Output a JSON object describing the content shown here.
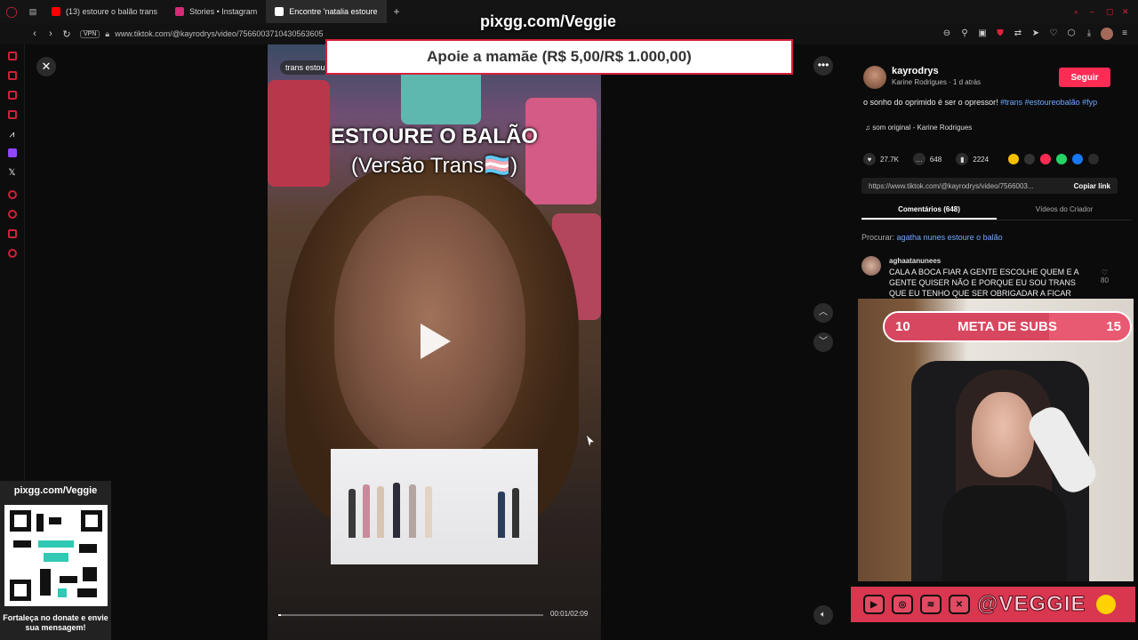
{
  "browser": {
    "tabs": [
      {
        "label": "(13) estoure o balão trans",
        "favicon_color": "#ff0000"
      },
      {
        "label": "Stories • Instagram",
        "favicon_color": "#d62976"
      },
      {
        "label": "Encontre 'natalia estoure",
        "favicon_color": "#ffffff",
        "active": true
      }
    ],
    "new_tab_label": "+",
    "url": "www.tiktok.com/@kayrodrys/video/7566003710430563605",
    "vpn_label": "VPN"
  },
  "overlay": {
    "stream_tag": "pixgg.com/Veggie",
    "donation_text": "Apoie a mamãe (R$ 5,00/R$ 1.000,00)"
  },
  "video": {
    "chip": "trans estou",
    "caption_line1": "ESTOURE O BALÃO",
    "caption_line2": "(Versão Trans🏳️‍⚧️)",
    "time": "00:01/02:09",
    "progress": 0.01
  },
  "post": {
    "username": "kayrodrys",
    "subline": "Karine Rodrigues · 1 d atrás",
    "follow_label": "Seguir",
    "description_text": "o sonho do oprimido é ser o opressor! ",
    "hashtags": "#trans #estoureobalão #fyp",
    "music": "som original - Karine Rodrigues",
    "likes": "27.7K",
    "comments": "648",
    "saves": "2224",
    "link": "https://www.tiktok.com/@kayrodrys/video/7566003...",
    "copy_link_label": "Copiar link",
    "tab_comments": "Comentários (648)",
    "tab_creator": "Vídeos do Criador",
    "search_prefix": "Procurar:",
    "search_query": "agatha nunes estoure o balão"
  },
  "comment": {
    "user": "aghaatanunees",
    "text": "CALA A BOCA FIAR A GENTE ESCOLHE QUEM E A GENTE QUISER NÃO E PORQUE EU SOU TRANS QUE EU TENHO QUE SER OBRIGADAR A FICAR",
    "likes": "80"
  },
  "subs_goal": {
    "current": "10",
    "label": "META DE SUBS",
    "target": "15",
    "progress": 0.67
  },
  "social": {
    "handle": "@VEGGIE"
  },
  "qr": {
    "title": "pixgg.com/Veggie",
    "caption": "Fortaleça no donate e envie sua mensagem!"
  },
  "colors": {
    "accent": "#fe2c55",
    "overlay_red": "#d9364f",
    "hashtag_blue": "#6fa8ff"
  }
}
